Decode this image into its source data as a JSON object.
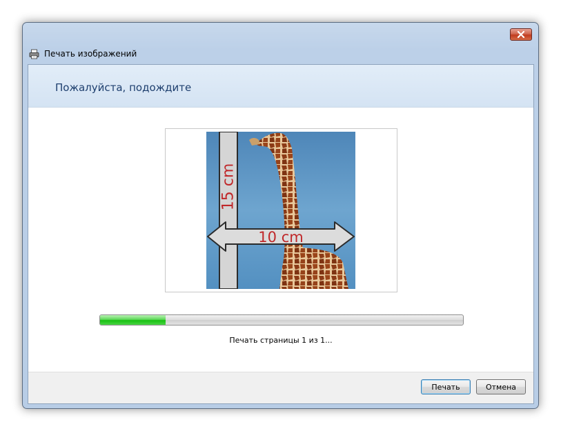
{
  "window": {
    "title": "Печать изображений",
    "close_icon": "close-icon",
    "app_icon": "printer-icon"
  },
  "header": {
    "title": "Пожалуйста, подождите"
  },
  "preview": {
    "width_label": "10 cm",
    "height_label": "15 cm"
  },
  "progress": {
    "fraction": 0.18,
    "status": "Печать страницы 1 из 1..."
  },
  "buttons": {
    "print_label": "Печать",
    "cancel_label": "Отмена"
  },
  "colors": {
    "accent_green": "#17c011",
    "header_title": "#1e3f6e",
    "label_red": "#c0282a"
  }
}
